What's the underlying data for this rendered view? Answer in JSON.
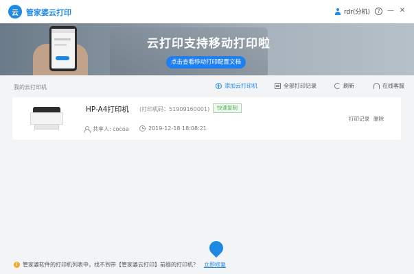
{
  "titlebar": {
    "logo_text": "云",
    "app_title": "管家婆云打印",
    "user_name": "rdr(分机)",
    "help_glyph": "?",
    "minimize_glyph": "—",
    "close_glyph": "✕"
  },
  "banner": {
    "heading": "云打印支持移动打印啦",
    "button_label": "点击查看移动打印配置文档"
  },
  "section": {
    "title": "我的云打印机",
    "toolbar": [
      {
        "label": "添加云打印机",
        "icon": "plus-circle-icon"
      },
      {
        "label": "全部打印记录",
        "icon": "document-icon"
      },
      {
        "label": "刷新",
        "icon": "refresh-icon"
      },
      {
        "label": "在线客服",
        "icon": "headset-icon"
      }
    ]
  },
  "printer": {
    "name": "HP-A4打印机",
    "code": "(打印机码：51909160001)",
    "badge": "快速复制",
    "sharer": "共享人: cocoa",
    "time": "2019-12-18 18:08:21",
    "records_link": "打印记录",
    "delete_link": "删除"
  },
  "footer": {
    "warning_glyph": "!",
    "message": "管家婆软件的打印机列表中，找不到带【管家婆云打印】前缀的打印机？",
    "link": "立即修复"
  }
}
